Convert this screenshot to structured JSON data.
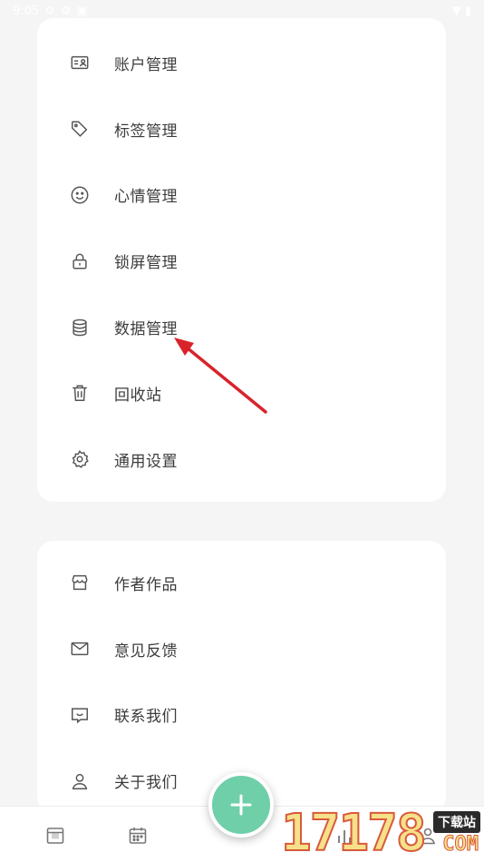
{
  "status_bar": {
    "time": "9:05"
  },
  "settings_group": {
    "items": [
      {
        "label": "账户管理",
        "icon": "account-card-icon"
      },
      {
        "label": "标签管理",
        "icon": "tag-icon"
      },
      {
        "label": "心情管理",
        "icon": "smiley-icon"
      },
      {
        "label": "锁屏管理",
        "icon": "lock-icon"
      },
      {
        "label": "数据管理",
        "icon": "database-icon"
      },
      {
        "label": "回收站",
        "icon": "trash-icon"
      },
      {
        "label": "通用设置",
        "icon": "gear-icon"
      }
    ]
  },
  "about_group": {
    "items": [
      {
        "label": "作者作品",
        "icon": "store-icon"
      },
      {
        "label": "意见反馈",
        "icon": "mail-icon"
      },
      {
        "label": "联系我们",
        "icon": "chat-icon"
      },
      {
        "label": "关于我们",
        "icon": "person-icon"
      }
    ]
  },
  "bottom_nav": {
    "items": [
      "archive-icon",
      "calendar-icon",
      "stats-icon",
      "profile-icon"
    ]
  },
  "fab": {
    "icon": "plus-icon"
  },
  "watermark": {
    "digits": "17178",
    "badge": "下载站",
    "suffix": "COM"
  },
  "colors": {
    "background": "#f5f5f5",
    "card": "#ffffff",
    "accent": "#6fcfa8",
    "arrow": "#d8232a"
  }
}
